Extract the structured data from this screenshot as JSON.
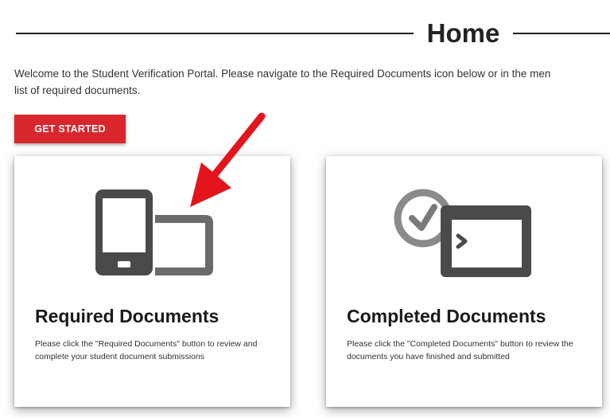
{
  "header": {
    "title": "Home"
  },
  "intro": {
    "line1": "Welcome to the Student Verification Portal. Please navigate to the Required Documents icon below or in the men",
    "line2": "list of required documents."
  },
  "actions": {
    "get_started_label": "GET STARTED"
  },
  "cards": [
    {
      "title": "Required Documents",
      "description": "Please click the \"Required Documents\" button to review and complete your student document submissions",
      "icon": "devices-icon"
    },
    {
      "title": "Completed Documents",
      "description": "Please click the \"Completed Documents\" button to review the documents you have finished and submitted",
      "icon": "clock-window-icon"
    }
  ],
  "annotation": {
    "icon": "red-arrow-icon",
    "color": "#e3141b"
  },
  "colors": {
    "accent": "#d9262d",
    "icon_dark": "#4a4a4a",
    "icon_mid": "#6b6b6b"
  }
}
